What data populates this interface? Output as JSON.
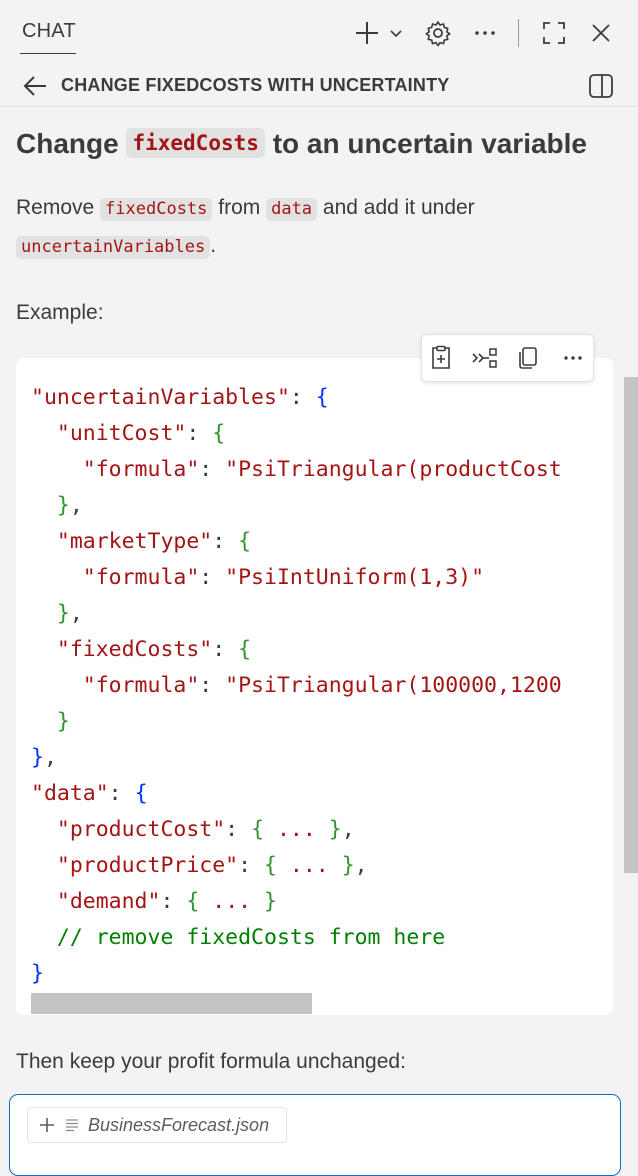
{
  "header": {
    "chat_tab": "CHAT",
    "icons": [
      "plus-icon",
      "chevron-down-icon",
      "gear-icon",
      "more-icon",
      "maximize-icon",
      "close-icon"
    ]
  },
  "conversation": {
    "title": "CHANGE FIXEDCOSTS WITH UNCERTAINTY"
  },
  "content": {
    "heading_before": "Change",
    "heading_code": "fixedCosts",
    "heading_after": "to an uncertain variable",
    "p1_text1": "Remove",
    "p1_code1": "fixedCosts",
    "p1_text2": "from",
    "p1_code2": "data",
    "p1_text3": "and add it under",
    "p2_code": "uncertainVariables",
    "p2_text": ".",
    "example_label": "Example:",
    "after_text": "Then keep your profit formula unchanged:"
  },
  "code": {
    "l1_key": "\"uncertainVariables\"",
    "l2_key": "\"unitCost\"",
    "l3_key": "\"formula\"",
    "l3_val": "\"PsiTriangular(productCost",
    "l5_key": "\"marketType\"",
    "l6_key": "\"formula\"",
    "l6_val": "\"PsiIntUniform(1,3)\"",
    "l8_key": "\"fixedCosts\"",
    "l9_key": "\"formula\"",
    "l9_val": "\"PsiTriangular(100000,1200",
    "l12_key": "\"data\"",
    "l13_key": "\"productCost\"",
    "l14_key": "\"productPrice\"",
    "l15_key": "\"demand\"",
    "ellipsis": "...",
    "comment": "// remove fixedCosts from here"
  },
  "input": {
    "attachment_name": "BusinessForecast.json"
  },
  "colors": {
    "accent": "#0e70c0",
    "code_string": "#a31515",
    "code_brace_level1": "#0431fa",
    "code_brace_level2": "#319331",
    "code_comment": "#008000"
  }
}
